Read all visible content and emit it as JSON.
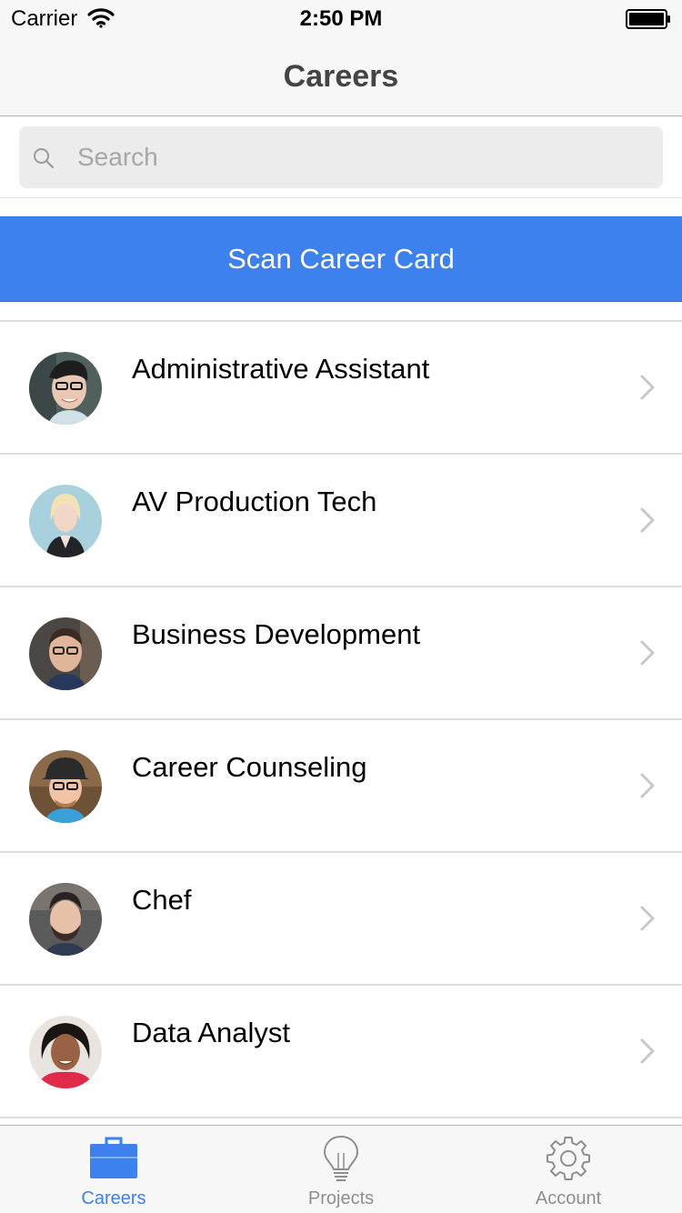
{
  "status_bar": {
    "carrier": "Carrier",
    "time": "2:50 PM"
  },
  "nav": {
    "title": "Careers"
  },
  "search": {
    "placeholder": "Search",
    "value": ""
  },
  "scan_button": {
    "label": "Scan Career Card"
  },
  "careers": [
    {
      "title": "Administrative Assistant",
      "avatar_icon": "person-avatar"
    },
    {
      "title": "AV Production Tech",
      "avatar_icon": "person-avatar"
    },
    {
      "title": "Business Development",
      "avatar_icon": "person-avatar"
    },
    {
      "title": "Career Counseling",
      "avatar_icon": "person-avatar"
    },
    {
      "title": "Chef",
      "avatar_icon": "person-avatar"
    },
    {
      "title": "Data Analyst",
      "avatar_icon": "person-avatar"
    }
  ],
  "tabs": [
    {
      "label": "Careers",
      "icon": "briefcase-icon",
      "active": true
    },
    {
      "label": "Projects",
      "icon": "lightbulb-icon",
      "active": false
    },
    {
      "label": "Account",
      "icon": "gear-icon",
      "active": false
    }
  ],
  "colors": {
    "accent": "#3d81ee",
    "bar_background": "#f7f7f7",
    "inactive_tab": "#8e8e8e"
  }
}
